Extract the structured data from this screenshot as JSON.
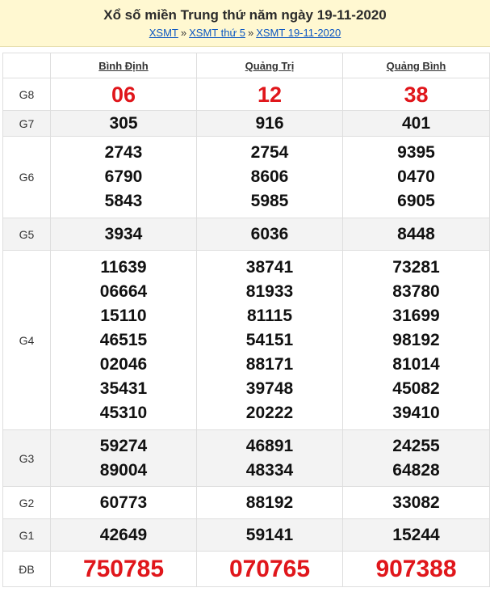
{
  "header": {
    "title": "Xổ số miền Trung thứ năm ngày 19-11-2020",
    "breadcrumb": [
      "XSMT",
      "XSMT thứ 5",
      "XSMT 19-11-2020"
    ],
    "separator": "»"
  },
  "table": {
    "provinces": [
      "Bình Định",
      "Quảng Trị",
      "Quảng Bình"
    ],
    "rows": [
      {
        "label": "G8",
        "values": [
          [
            "06"
          ],
          [
            "12"
          ],
          [
            "38"
          ]
        ]
      },
      {
        "label": "G7",
        "values": [
          [
            "305"
          ],
          [
            "916"
          ],
          [
            "401"
          ]
        ]
      },
      {
        "label": "G6",
        "values": [
          [
            "2743",
            "6790",
            "5843"
          ],
          [
            "2754",
            "8606",
            "5985"
          ],
          [
            "9395",
            "0470",
            "6905"
          ]
        ]
      },
      {
        "label": "G5",
        "values": [
          [
            "3934"
          ],
          [
            "6036"
          ],
          [
            "8448"
          ]
        ]
      },
      {
        "label": "G4",
        "values": [
          [
            "11639",
            "06664",
            "15110",
            "46515",
            "02046",
            "35431",
            "45310"
          ],
          [
            "38741",
            "81933",
            "81115",
            "54151",
            "88171",
            "39748",
            "20222"
          ],
          [
            "73281",
            "83780",
            "31699",
            "98192",
            "81014",
            "45082",
            "39410"
          ]
        ]
      },
      {
        "label": "G3",
        "values": [
          [
            "59274",
            "89004"
          ],
          [
            "46891",
            "48334"
          ],
          [
            "24255",
            "64828"
          ]
        ]
      },
      {
        "label": "G2",
        "values": [
          [
            "60773"
          ],
          [
            "88192"
          ],
          [
            "33082"
          ]
        ]
      },
      {
        "label": "G1",
        "values": [
          [
            "42649"
          ],
          [
            "59141"
          ],
          [
            "15244"
          ]
        ]
      },
      {
        "label": "ĐB",
        "values": [
          [
            "750785"
          ],
          [
            "070765"
          ],
          [
            "907388"
          ]
        ]
      }
    ]
  },
  "colors": {
    "special": "#e0161b",
    "header_bg": "#fff8d1",
    "link": "#0a56c2",
    "alt_row": "#f3f3f3"
  }
}
